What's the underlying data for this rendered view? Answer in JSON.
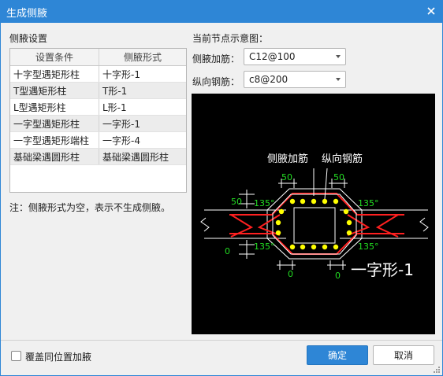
{
  "window": {
    "title": "生成侧腋"
  },
  "left": {
    "section_title": "侧腋设置",
    "columns": [
      "设置条件",
      "侧腋形式"
    ],
    "rows": [
      [
        "十字型遇矩形柱",
        "十字形-1"
      ],
      [
        "T型遇矩形柱",
        "T形-1"
      ],
      [
        "L型遇矩形柱",
        "L形-1"
      ],
      [
        "一字型遇矩形柱",
        "一字形-1"
      ],
      [
        "一字型遇矩形端柱",
        "一字形-4"
      ],
      [
        "基础梁遇圆形柱",
        "基础梁遇圆形柱"
      ]
    ],
    "note": "注：侧腋形式为空，表示不生成侧腋。"
  },
  "right": {
    "diagram_title": "当前节点示意图：",
    "side_rebar": {
      "label": "侧腋加筋：",
      "value": "C12@100"
    },
    "long_rebar": {
      "label": "纵向钢筋：",
      "value": "c8@200"
    }
  },
  "diagram": {
    "label_side": "侧腋加筋",
    "label_long": "纵向钢筋",
    "dim_50_a": "50",
    "dim_50_b": "50",
    "dim_50_left": "50",
    "angle_a": "135°",
    "angle_b": "135°",
    "angle_c": "135°",
    "angle_d": "135°",
    "dim_0_a": "0",
    "dim_0_b": "0",
    "dim_0_c": "0",
    "shape_name": "一字形-1",
    "colors": {
      "bg": "#000000",
      "line": "#ffffff",
      "rebar": "#ff2020",
      "bar": "#ffff00",
      "dim": "#22dd22"
    }
  },
  "footer": {
    "overwrite_label": "覆盖同位置加腋",
    "overwrite_checked": false,
    "ok_label": "确定",
    "cancel_label": "取消"
  }
}
